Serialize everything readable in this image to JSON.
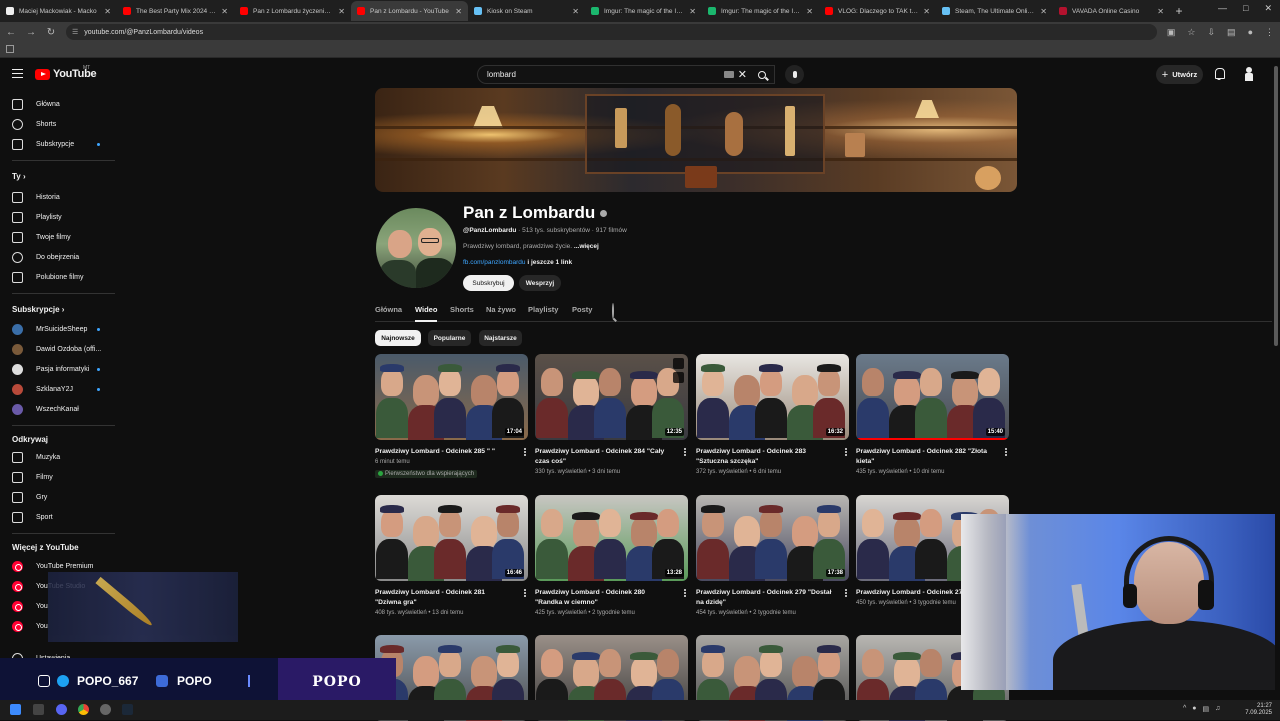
{
  "browser": {
    "tabs": [
      {
        "title": "Maciej Mackowiak - Macko",
        "color": "#eeeeee",
        "active": false
      },
      {
        "title": "The Best Party Mix 2024 | Rem",
        "color": "#ff0000",
        "active": false
      },
      {
        "title": "Pan z Lombardu życzenia urod",
        "color": "#ff0000",
        "active": false
      },
      {
        "title": "Pan z Lombardu - YouTube",
        "color": "#ff0000",
        "active": true
      },
      {
        "title": "Kiosk on Steam",
        "color": "#66c0f4",
        "active": false
      },
      {
        "title": "Imgur: The magic of the Intern",
        "color": "#1bb76e",
        "active": false
      },
      {
        "title": "Imgur: The magic of the Intern",
        "color": "#1bb76e",
        "active": false
      },
      {
        "title": "VLOG: Dlaczego to TAK trudne",
        "color": "#ff0000",
        "active": false
      },
      {
        "title": "Steam, The Ultimate Online Ga",
        "color": "#66c0f4",
        "active": false
      },
      {
        "title": "VAVADA Online Casino",
        "color": "#b3122e",
        "active": false
      }
    ],
    "url": "youtube.com/@PanzLombardu/videos"
  },
  "header": {
    "logo_text": "YouTube",
    "region": "MT",
    "search_value": "lombard",
    "create_label": "Utwórz"
  },
  "sidebar": {
    "main": [
      {
        "label": "Główna"
      },
      {
        "label": "Shorts"
      },
      {
        "label": "Subskrypcje"
      }
    ],
    "you_heading": "Ty",
    "you": [
      {
        "label": "Historia"
      },
      {
        "label": "Playlisty"
      },
      {
        "label": "Twoje filmy"
      },
      {
        "label": "Do obejrzenia"
      },
      {
        "label": "Polubione filmy"
      }
    ],
    "subs_heading": "Subskrypcje",
    "subs": [
      {
        "label": "MrSuicideSheep",
        "color": "#3a6ea8"
      },
      {
        "label": "Dawid Ozdoba (offi...",
        "color": "#7a5a3a"
      },
      {
        "label": "Pasja informatyki",
        "color": "#dddddd"
      },
      {
        "label": "SzklanaY2J",
        "color": "#b84a3a"
      },
      {
        "label": "WszechKanał",
        "color": "#6a5aa8"
      }
    ],
    "explore_heading": "Odkrywaj",
    "explore": [
      {
        "label": "Muzyka"
      },
      {
        "label": "Filmy"
      },
      {
        "label": "Gry"
      },
      {
        "label": "Sport"
      }
    ],
    "more_heading": "Więcej z YouTube",
    "more": [
      {
        "label": "YouTube Premium"
      },
      {
        "label": "YouTube Studio"
      },
      {
        "label": "You"
      },
      {
        "label": "You"
      }
    ],
    "settings_label": "Ustawienia"
  },
  "channel": {
    "name": "Pan z Lombardu",
    "handle": "@PanzLombardu",
    "stats": "· 513 tys. subskrybentów · 917 filmów",
    "description": "Prawdziwy lombard, prawdziwe życie.",
    "more_label": "...więcej",
    "link": "fb.com/panzlombardu",
    "link_more": "i jeszcze 1 link",
    "subscribe_label": "Subskrybuj",
    "support_label": "Wesprzyj"
  },
  "tabs": [
    "Główna",
    "Wideo",
    "Shorts",
    "Na żywo",
    "Playlisty",
    "Posty"
  ],
  "active_tab": "Wideo",
  "chips": [
    "Najnowsze",
    "Popularne",
    "Najstarsze"
  ],
  "active_chip": "Najnowsze",
  "videos": [
    {
      "title": "Prawdziwy Lombard - Odcinek 285 \" \"",
      "meta": "6 minut temu",
      "badge": "Pierwszeństwo dla wspierających",
      "duration": "17:04",
      "bg": [
        "#4a5a6a",
        "#8a6a4a"
      ]
    },
    {
      "title": "Prawdziwy Lombard - Odcinek 284 \"Cały czas coś\"",
      "meta": "330 tys. wyświetleń • 3 dni temu",
      "duration": "12:35",
      "bg": [
        "#5a5048",
        "#3a3a40"
      ],
      "icons": true
    },
    {
      "title": "Prawdziwy Lombard - Odcinek 283 \"Sztuczna szczęka\"",
      "meta": "372 tys. wyświetleń • 6 dni temu",
      "duration": "16:32",
      "bg": [
        "#e8e6e2",
        "#9a8a7a"
      ]
    },
    {
      "title": "Prawdziwy Lombard - Odcinek 282 \"Złota kieta\"",
      "meta": "435 tys. wyświetleń • 10 dni temu",
      "duration": "15:40",
      "bg": [
        "#6a7a8a",
        "#4a4a50"
      ],
      "watched": 1.0
    },
    {
      "title": "Prawdziwy Lombard - Odcinek 281 \"Dziwna gra\"",
      "meta": "408 tys. wyświetleń • 13 dni temu",
      "duration": "16:46",
      "bg": [
        "#dcdad6",
        "#8a8a8a"
      ]
    },
    {
      "title": "Prawdziwy Lombard - Odcinek 280 \"Randka w ciemno\"",
      "meta": "425 tys. wyświetleń • 2 tygodnie temu",
      "duration": "13:28",
      "bg": [
        "#c8c6c2",
        "#5a9a5a"
      ]
    },
    {
      "title": "Prawdziwy Lombard - Odcinek 279 \"Dostał na dzidę\"",
      "meta": "454 tys. wyświetleń • 2 tygodnie temu",
      "duration": "17:38",
      "bg": [
        "#b8b6b2",
        "#4a4a60"
      ]
    },
    {
      "title": "Prawdziwy Lombard - Odcinek 27 dżungla\"",
      "meta": "450 tys. wyświetleń • 3 tygodnie temu",
      "duration": "",
      "bg": [
        "#d8d6d2",
        "#6a6a7a"
      ]
    },
    {
      "title": "",
      "meta": "",
      "duration": "",
      "bg": [
        "#8a9aaa",
        "#4a4a4a"
      ]
    },
    {
      "title": "",
      "meta": "",
      "duration": "",
      "bg": [
        "#9a9088",
        "#3a3a3a"
      ]
    },
    {
      "title": "",
      "meta": "",
      "duration": "",
      "bg": [
        "#a8a6a2",
        "#4a4a4a"
      ]
    },
    {
      "title": "",
      "meta": "",
      "duration": "",
      "bg": [
        "#b8b6b2",
        "#5a5a5a"
      ]
    }
  ],
  "promo": {
    "handle1": "POPO_667",
    "handle2": "POPO",
    "badge": "POPO"
  },
  "taskbar": {
    "time": "21:27",
    "date": "7.09.2025"
  }
}
